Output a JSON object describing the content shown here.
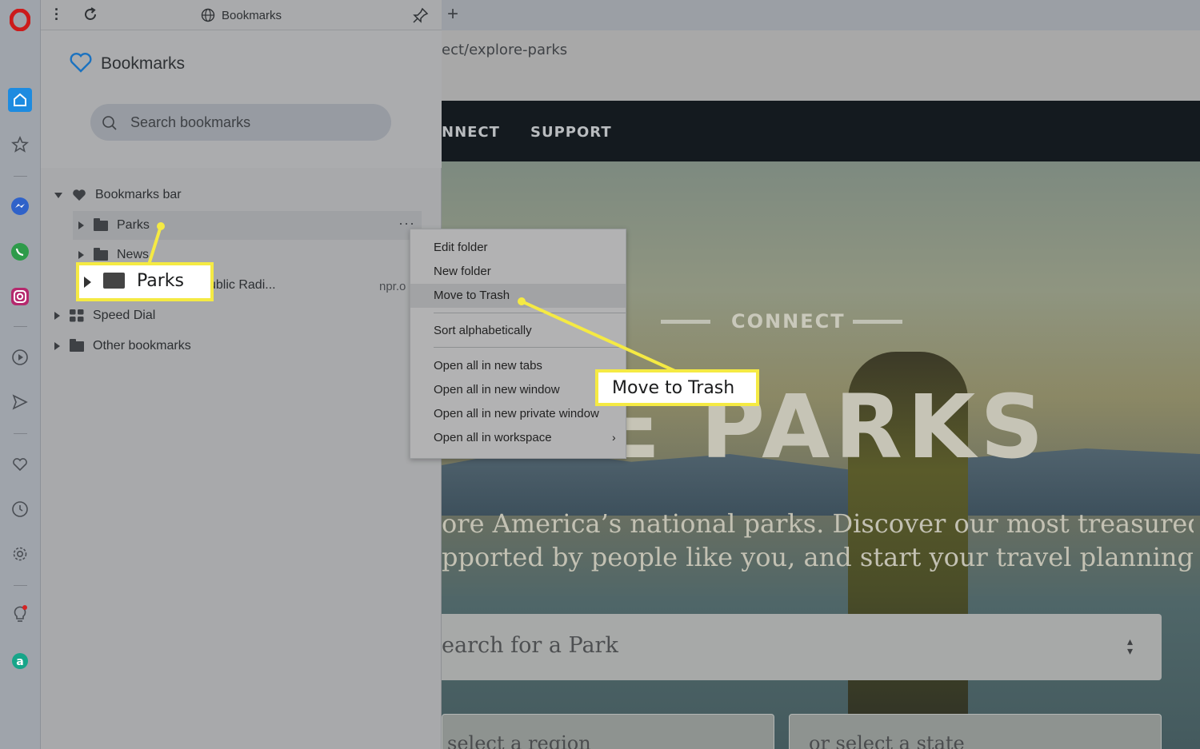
{
  "tabstrip": {
    "panel_title": "Bookmarks",
    "new_tab_symbol": "+"
  },
  "address": {
    "url_fragment": "ect/explore-parks"
  },
  "site": {
    "nav": [
      "NNECT",
      "SUPPORT"
    ],
    "connect_label": "CONNECT",
    "hero_title": "ORE PARKS",
    "hero_desc_line1": "ore America’s national parks. Discover our most treasured places,",
    "hero_desc_line2": "pported by people like you, and start your travel planning here.",
    "search_placeholder": "earch for a Park",
    "region_select": "select a region",
    "state_select": "or select a state"
  },
  "bookmarks_panel": {
    "title": "Bookmarks",
    "search_placeholder": "Search bookmarks",
    "tree": {
      "bookmarks_bar": "Bookmarks bar",
      "parks": "Parks",
      "news": "News",
      "npr_title": "ublic Radi...",
      "npr_url": "npr.o",
      "speed_dial": "Speed Dial",
      "other_bookmarks": "Other bookmarks"
    }
  },
  "context_menu": {
    "edit_folder": "Edit folder",
    "new_folder": "New folder",
    "move_to_trash": "Move to Trash",
    "sort_alpha": "Sort alphabetically",
    "open_new_tabs": "Open all in new tabs",
    "open_new_window": "Open all in new window",
    "open_private": "Open all in new private window",
    "open_workspace": "Open all in workspace"
  },
  "callouts": {
    "parks": "Parks",
    "move_to_trash": "Move to Trash"
  },
  "colors": {
    "callout_border": "#f5ea43",
    "opera_red": "#cc1b1b",
    "sidebar_accent": "#1d8be0"
  }
}
